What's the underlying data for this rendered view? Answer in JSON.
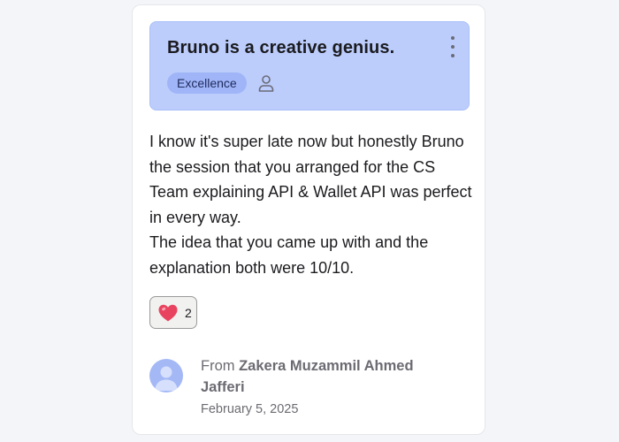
{
  "card": {
    "title": "Bruno is a creative genius.",
    "badge": "Excellence",
    "message": "I know it's super late now but honestly Bruno the session that you arranged for the CS Team explaining API & Wallet API was perfect in every way.\nThe idea that you came up with and the explanation both were 10/10.",
    "reaction": {
      "icon": "heart-icon",
      "count": "2"
    },
    "author": {
      "prefix": "From",
      "name": "Zakera Muzammil Ahmed Jafferi",
      "date": "February 5, 2025"
    }
  },
  "colors": {
    "header_bg": "#bccdfc",
    "badge_bg": "#9fb5f7",
    "avatar_bg": "#a4b8f6",
    "heart": "#e8445f"
  }
}
